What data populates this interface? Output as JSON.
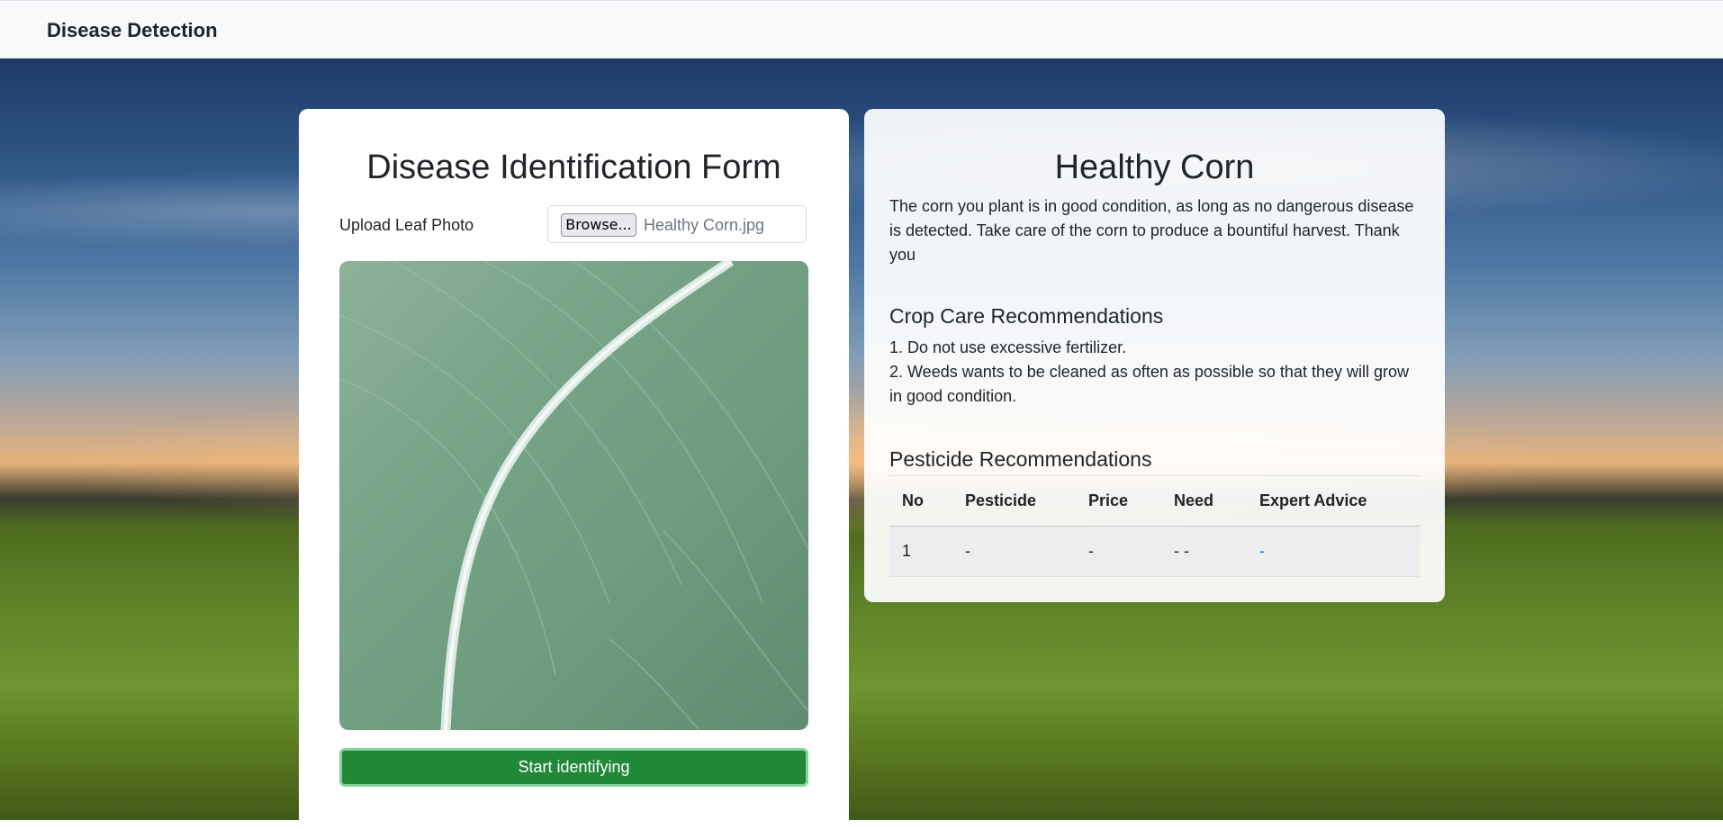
{
  "navbar": {
    "brand": "Disease Detection"
  },
  "form": {
    "title": "Disease Identification Form",
    "upload_label": "Upload Leaf Photo",
    "browse_label": "Browse...",
    "file_name": "Healthy Corn.jpg",
    "submit_label": "Start identifying"
  },
  "result": {
    "title": "Healthy Corn",
    "description": "The corn you plant is in good condition, as long as no dangerous disease is detected. Take care of the corn to produce a bountiful harvest. Thank you",
    "care_title": "Crop Care Recommendations",
    "care_items": [
      "1. Do not use excessive fertilizer.",
      "2. Weeds wants to be cleaned as often as possible so that they will grow in good condition."
    ],
    "pesticide_title": "Pesticide Recommendations",
    "table": {
      "headers": [
        "No",
        "Pesticide",
        "Price",
        "Need",
        "Expert Advice"
      ],
      "rows": [
        [
          "1",
          "-",
          "-",
          "- -",
          "-"
        ]
      ]
    }
  },
  "colors": {
    "navbar_bg": "#f8f9fa",
    "submit_bg": "#218838",
    "link": "#0d6efd"
  }
}
